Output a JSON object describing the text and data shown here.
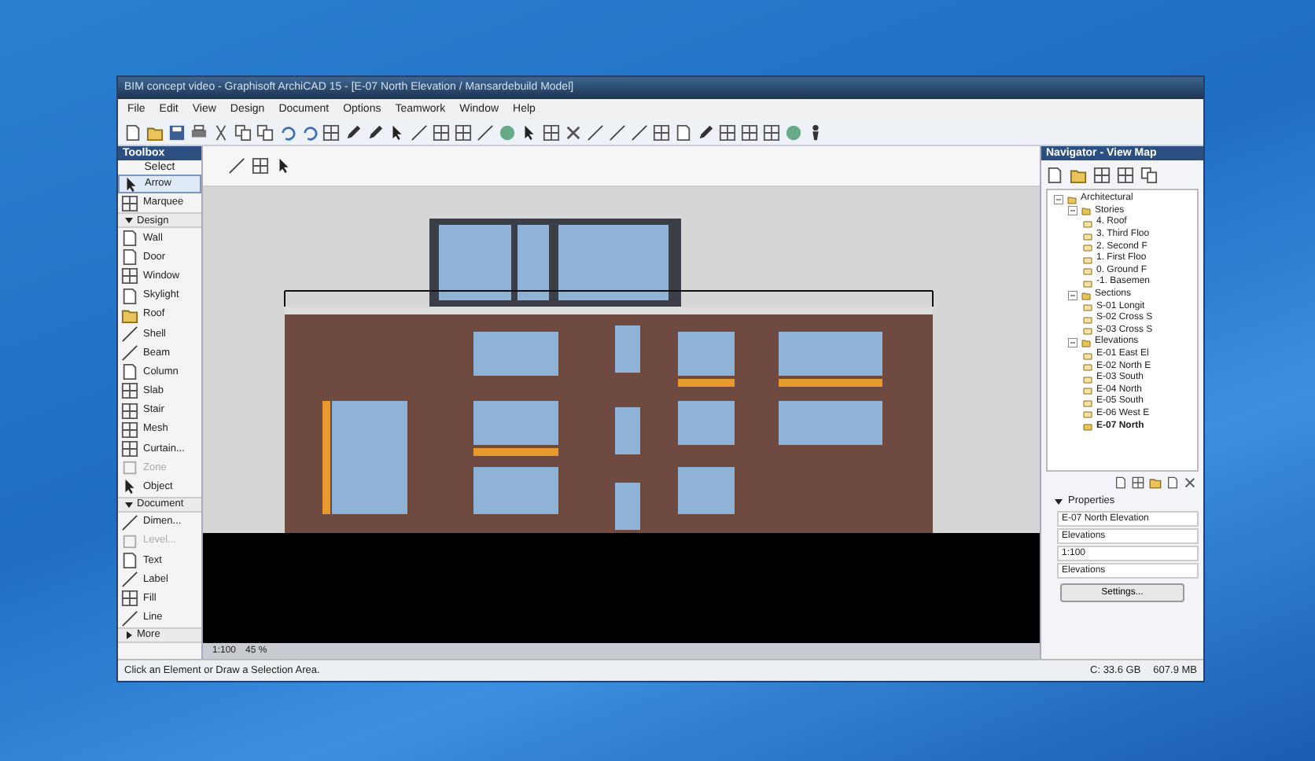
{
  "window": {
    "title": "BIM concept video - Graphisoft ArchiCAD 15 - [E-07 North Elevation / Mansardebuild Model]"
  },
  "menu": [
    "File",
    "Edit",
    "View",
    "Design",
    "Document",
    "Options",
    "Teamwork",
    "Window",
    "Help"
  ],
  "toolbox": {
    "title": "Toolbox",
    "select_label": "Select",
    "items": [
      {
        "kind": "tool",
        "label": "Arrow",
        "selected": true,
        "disabled": false
      },
      {
        "kind": "tool",
        "label": "Marquee",
        "selected": false,
        "disabled": false
      },
      {
        "kind": "section",
        "label": "Design",
        "expanded": true
      },
      {
        "kind": "tool",
        "label": "Wall",
        "selected": false,
        "disabled": false
      },
      {
        "kind": "tool",
        "label": "Door",
        "selected": false,
        "disabled": false
      },
      {
        "kind": "tool",
        "label": "Window",
        "selected": false,
        "disabled": false
      },
      {
        "kind": "tool",
        "label": "Skylight",
        "selected": false,
        "disabled": false
      },
      {
        "kind": "tool",
        "label": "Roof",
        "selected": false,
        "disabled": false
      },
      {
        "kind": "tool",
        "label": "Shell",
        "selected": false,
        "disabled": false
      },
      {
        "kind": "tool",
        "label": "Beam",
        "selected": false,
        "disabled": false
      },
      {
        "kind": "tool",
        "label": "Column",
        "selected": false,
        "disabled": false
      },
      {
        "kind": "tool",
        "label": "Slab",
        "selected": false,
        "disabled": false
      },
      {
        "kind": "tool",
        "label": "Stair",
        "selected": false,
        "disabled": false
      },
      {
        "kind": "tool",
        "label": "Mesh",
        "selected": false,
        "disabled": false
      },
      {
        "kind": "tool",
        "label": "Curtain...",
        "selected": false,
        "disabled": false
      },
      {
        "kind": "tool",
        "label": "Zone",
        "selected": false,
        "disabled": true
      },
      {
        "kind": "tool",
        "label": "Object",
        "selected": false,
        "disabled": false
      },
      {
        "kind": "section",
        "label": "Document",
        "expanded": true
      },
      {
        "kind": "tool",
        "label": "Dimen...",
        "selected": false,
        "disabled": false
      },
      {
        "kind": "tool",
        "label": "Level...",
        "selected": false,
        "disabled": true
      },
      {
        "kind": "tool",
        "label": "Text",
        "selected": false,
        "disabled": false
      },
      {
        "kind": "tool",
        "label": "Label",
        "selected": false,
        "disabled": false
      },
      {
        "kind": "tool",
        "label": "Fill",
        "selected": false,
        "disabled": false
      },
      {
        "kind": "tool",
        "label": "Line",
        "selected": false,
        "disabled": false
      },
      {
        "kind": "section",
        "label": "More",
        "expanded": false
      }
    ]
  },
  "canvas_bar": {
    "scale": "1:100",
    "zoom": "45 %"
  },
  "navigator": {
    "title": "Navigator - View Map",
    "tree": [
      {
        "label": "Architectural",
        "expanded": true,
        "selected": false,
        "children": [
          {
            "label": "Stories",
            "expanded": true,
            "selected": false,
            "children": [
              {
                "label": "4. Roof",
                "selected": false
              },
              {
                "label": "3. Third Floo",
                "selected": false
              },
              {
                "label": "2. Second F",
                "selected": false
              },
              {
                "label": "1. First Floo",
                "selected": false
              },
              {
                "label": "0. Ground F",
                "selected": false
              },
              {
                "label": "-1. Basemen",
                "selected": false
              }
            ]
          },
          {
            "label": "Sections",
            "expanded": true,
            "selected": false,
            "children": [
              {
                "label": "S-01 Longit",
                "selected": false
              },
              {
                "label": "S-02 Cross S",
                "selected": false
              },
              {
                "label": "S-03 Cross S",
                "selected": false
              }
            ]
          },
          {
            "label": "Elevations",
            "expanded": true,
            "selected": false,
            "children": [
              {
                "label": "E-01 East El",
                "selected": false
              },
              {
                "label": "E-02 North E",
                "selected": false
              },
              {
                "label": "E-03 South",
                "selected": false
              },
              {
                "label": "E-04 North",
                "selected": false
              },
              {
                "label": "E-05 South",
                "selected": false
              },
              {
                "label": "E-06 West E",
                "selected": false
              },
              {
                "label": "E-07 North",
                "selected": true
              }
            ]
          }
        ]
      }
    ]
  },
  "properties": {
    "title": "Properties",
    "expanded": true,
    "fields": [
      "E-07 North Elevation",
      "Elevations",
      "1:100",
      "Elevations"
    ],
    "button": "Settings..."
  },
  "status_bar": {
    "message": "Click an Element or Draw a Selection Area.",
    "disk": "C: 33.6 GB",
    "memory": "607.9 MB"
  }
}
